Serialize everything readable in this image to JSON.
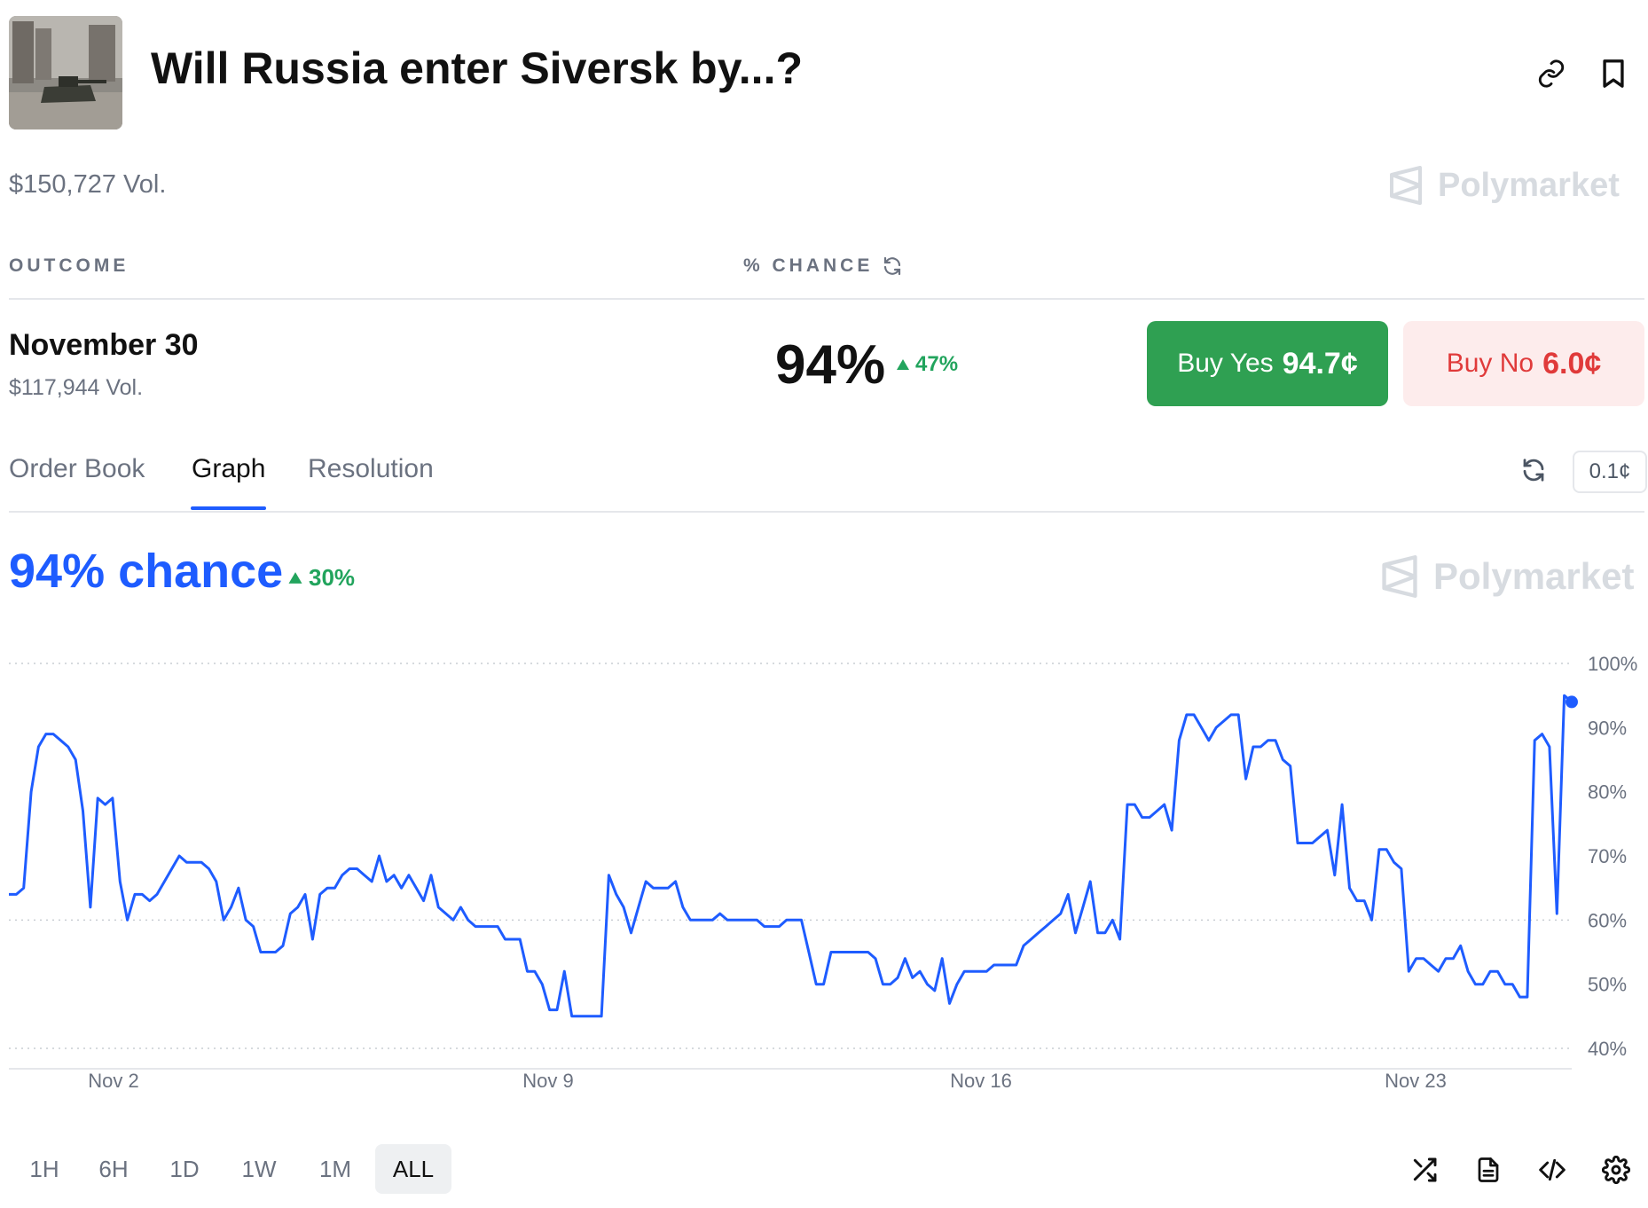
{
  "header": {
    "title": "Will Russia enter Siversk by...?",
    "volume": "$150,727 Vol.",
    "brand": "Polymarket",
    "icons": [
      "link-icon",
      "bookmark-icon"
    ]
  },
  "table": {
    "col_outcome": "OUTCOME",
    "col_chance": "% CHANCE",
    "row": {
      "name": "November 30",
      "volume": "$117,944 Vol.",
      "chance": "94%",
      "delta": "47%",
      "buy_yes_label": "Buy Yes",
      "buy_yes_price": "94.7¢",
      "buy_no_label": "Buy No",
      "buy_no_price": "6.0¢"
    }
  },
  "tabs": {
    "items": [
      "Order Book",
      "Graph",
      "Resolution"
    ],
    "active": "Graph",
    "tick_size": "0.1¢"
  },
  "graph": {
    "chance_text": "94% chance",
    "delta": "30%",
    "brand": "Polymarket"
  },
  "chart_data": {
    "type": "line",
    "x_ticks": [
      "Nov 2",
      "Nov 9",
      "Nov 16",
      "Nov 23"
    ],
    "y_ticks": [
      "100%",
      "90%",
      "80%",
      "70%",
      "60%",
      "50%",
      "40%"
    ],
    "ylim": [
      40,
      100
    ],
    "series": [
      {
        "color": "#1e5cff",
        "values": [
          64,
          64,
          65,
          80,
          87,
          89,
          89,
          88,
          87,
          85,
          77,
          62,
          79,
          78,
          79,
          66,
          60,
          64,
          64,
          63,
          64,
          66,
          68,
          70,
          69,
          69,
          69,
          68,
          66,
          60,
          62,
          65,
          60,
          59,
          55,
          55,
          55,
          56,
          61,
          62,
          64,
          57,
          64,
          65,
          65,
          67,
          68,
          68,
          67,
          66,
          70,
          66,
          67,
          65,
          67,
          65,
          63,
          67,
          62,
          61,
          60,
          62,
          60,
          59,
          59,
          59,
          59,
          57,
          57,
          57,
          52,
          52,
          50,
          46,
          46,
          52,
          45,
          45,
          45,
          45,
          45,
          67,
          64,
          62,
          58,
          62,
          66,
          65,
          65,
          65,
          66,
          62,
          60,
          60,
          60,
          60,
          61,
          60,
          60,
          60,
          60,
          60,
          59,
          59,
          59,
          60,
          60,
          60,
          55,
          50,
          50,
          55,
          55,
          55,
          55,
          55,
          55,
          54,
          50,
          50,
          51,
          54,
          51,
          52,
          50,
          49,
          54,
          47,
          50,
          52,
          52,
          52,
          52,
          53,
          53,
          53,
          53,
          56,
          57,
          58,
          59,
          60,
          61,
          64,
          58,
          62,
          66,
          58,
          58,
          60,
          57,
          78,
          78,
          76,
          76,
          77,
          78,
          74,
          88,
          92,
          92,
          90,
          88,
          90,
          91,
          92,
          92,
          82,
          87,
          87,
          88,
          88,
          85,
          84,
          72,
          72,
          72,
          73,
          74,
          67,
          78,
          65,
          63,
          63,
          60,
          71,
          71,
          69,
          68,
          52,
          54,
          54,
          53,
          52,
          54,
          54,
          56,
          52,
          50,
          50,
          52,
          52,
          50,
          50,
          48,
          48,
          88,
          89,
          87,
          61,
          95,
          94
        ]
      }
    ],
    "last_value": 94,
    "x_range": [
      "",
      ""
    ],
    "grid": true
  },
  "controls": {
    "ranges": [
      "1H",
      "6H",
      "1D",
      "1W",
      "1M",
      "ALL"
    ],
    "active_range": "ALL",
    "tools": [
      "shuffle-icon",
      "document-icon",
      "code-icon",
      "settings-icon"
    ]
  }
}
